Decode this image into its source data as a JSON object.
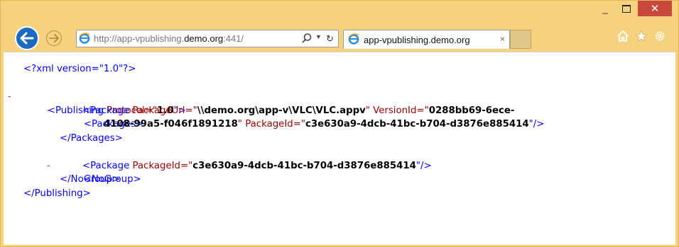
{
  "window": {
    "minimize_glyph": "_",
    "close_glyph": "✕"
  },
  "nav": {
    "address_prefix": "http://app-vpublishing.",
    "address_domain": "demo.org",
    "address_suffix": ":441/",
    "tab_title": "app-vpublishing.demo.org",
    "tab_close": "×"
  },
  "colors": {
    "frame": "#f6d27e",
    "back_button": "#1b6ac2",
    "close_button": "#c9483c",
    "xml_blue": "#0000ff",
    "xml_tag": "#990000",
    "xml_minus": "#e0342c"
  },
  "icons": {
    "back": "back-arrow-icon",
    "forward": "forward-arrow-icon",
    "ie": "internet-explorer-icon",
    "search": "search-icon",
    "refresh": "refresh-icon",
    "home": "home-icon",
    "favorites": "star-icon",
    "tools": "gear-icon"
  },
  "xml": {
    "minus": "-",
    "decl": "<?xml version=\"1.0\"?>",
    "pub_open_start": "<Publishing ",
    "pub_attr": "Protocol=\"",
    "pub_val": "1.0",
    "pub_close_q": "\">",
    "pkgs_open": "<Packages>",
    "pkg_open": "<Package ",
    "pkg_url_attr": "PackageUrl=\"",
    "pkg_url_val": "\\\\demo.org\\app-v\\VLC\\VLC.appv",
    "q": "\"",
    "ver_attr": " VersionId=\"",
    "ver_val_1": "0288bb69-6ece-",
    "ver_val_2": "4108-99a5-f046f1891218",
    "pid_attr": " PackageId=\"",
    "pid_val": "c3e630a9-4dcb-41bc-b704-d3876e885414",
    "self_close": "\"/>",
    "pkgs_close": "</Packages>",
    "nog_open": "<NoGroup>",
    "pkg2_open": "<Package ",
    "pid2_attr": "PackageId=\"",
    "pid2_val": "c3e630a9-4dcb-41bc-b704-d3876e885414",
    "nog_close": "</NoGroup>",
    "pub_close": "</Publishing>"
  }
}
